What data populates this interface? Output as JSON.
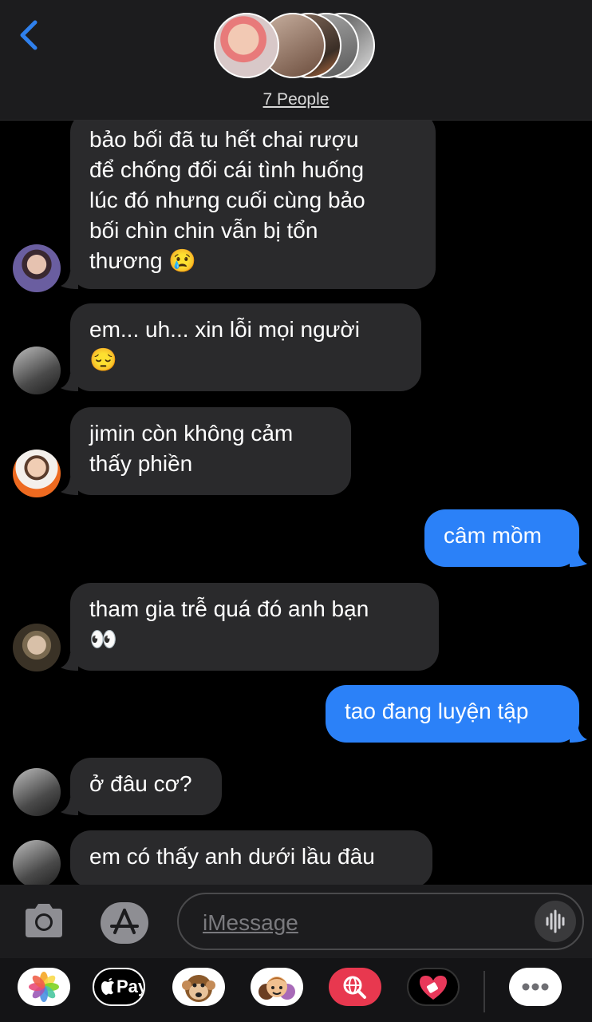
{
  "header": {
    "group_label": "7 People"
  },
  "messages": [
    {
      "side": "received",
      "lines": [
        "bảo bối đã tu hết chai rượu",
        "để chống đối cái tình huống",
        "lúc đó nhưng cuối cùng bảo",
        "bối chìn chin vẫn bị tổn",
        "thương 😢"
      ]
    },
    {
      "side": "received",
      "lines": [
        "em... uh... xin lỗi mọi người",
        "😔"
      ]
    },
    {
      "side": "received",
      "lines": [
        "jimin còn không cảm",
        "thấy phiền"
      ]
    },
    {
      "side": "sent",
      "lines": [
        "câm mồm"
      ]
    },
    {
      "side": "received",
      "lines": [
        "tham gia trễ quá đó anh bạn",
        "👀"
      ]
    },
    {
      "side": "sent",
      "lines": [
        "tao đang luyện tập"
      ]
    },
    {
      "side": "received",
      "lines": [
        "ở đâu cơ?"
      ]
    },
    {
      "side": "received",
      "lines": [
        "em có thấy anh dưới lầu đâu"
      ]
    }
  ],
  "composer": {
    "placeholder": "iMessage",
    "apps": [
      "photos-icon",
      "apple-pay-icon",
      "animoji-icon",
      "memoji-icon",
      "web-search-icon",
      "digital-touch-icon",
      "more-icon"
    ],
    "apple_pay_label": "Pay"
  },
  "colors": {
    "sent_bubble": "#2b81f8",
    "received_bubble": "#2a2a2c",
    "accent": "#2f80ed"
  }
}
